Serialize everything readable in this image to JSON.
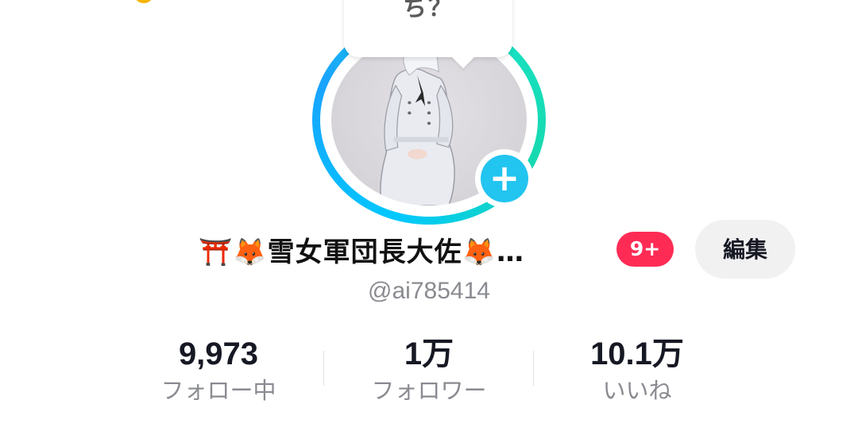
{
  "avatar": {
    "bubble_text": "ち？",
    "add_button_glyph": "+"
  },
  "profile": {
    "display_name": "⛩️🦊雪女軍団長大佐🦊…",
    "notification_badge": "9+",
    "edit_button_label": "編集",
    "username": "@ai785414"
  },
  "stats": [
    {
      "value": "9,973",
      "label": "フォロー中"
    },
    {
      "value": "1万",
      "label": "フォロワー"
    },
    {
      "value": "10.1万",
      "label": "いいね"
    }
  ],
  "colors": {
    "ring_start": "#00c8ff",
    "ring_end": "#19e3c8",
    "add_button": "#22c4f0",
    "badge": "#fe2c55",
    "edit_button_bg": "#f1f1f2"
  },
  "icons": {
    "add": "plus-icon",
    "torii": "torii-gate-emoji",
    "fox": "fox-emoji"
  }
}
